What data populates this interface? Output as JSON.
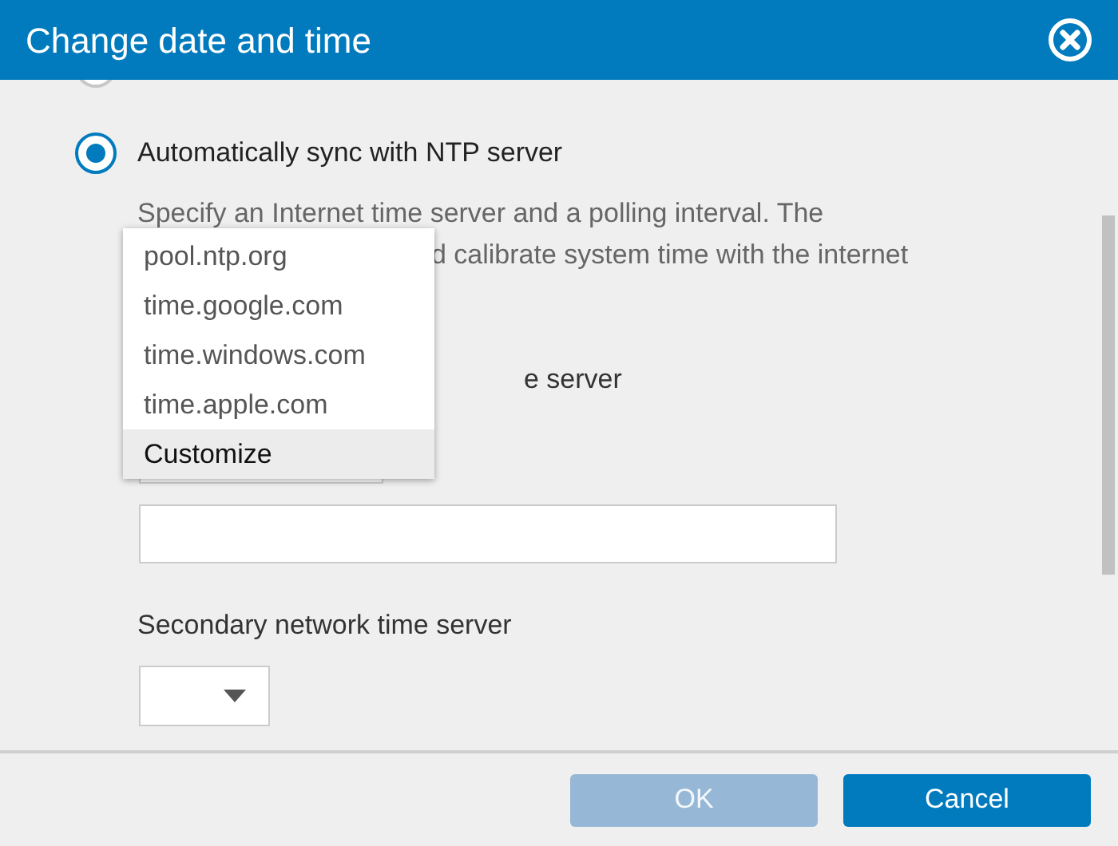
{
  "window": {
    "title": "Change date and time"
  },
  "sync_options": [
    {
      "selected": false
    },
    {
      "label": "Automatically sync with NTP server",
      "selected": true
    }
  ],
  "description_lines": [
    "Specify an Internet time server and a polling interval. The",
    "d calibrate system time with the internet"
  ],
  "primary_label": "e server",
  "secondary_label": "Secondary network time server",
  "dropdown": {
    "items": [
      {
        "label": "pool.ntp.org",
        "selected": false
      },
      {
        "label": "time.google.com",
        "selected": false
      },
      {
        "label": "time.windows.com",
        "selected": false
      },
      {
        "label": "time.apple.com",
        "selected": false
      },
      {
        "label": "Customize",
        "selected": true
      }
    ]
  },
  "buttons": [
    {
      "label": "OK",
      "disabled": true
    },
    {
      "label": "Cancel",
      "disabled": false
    }
  ]
}
